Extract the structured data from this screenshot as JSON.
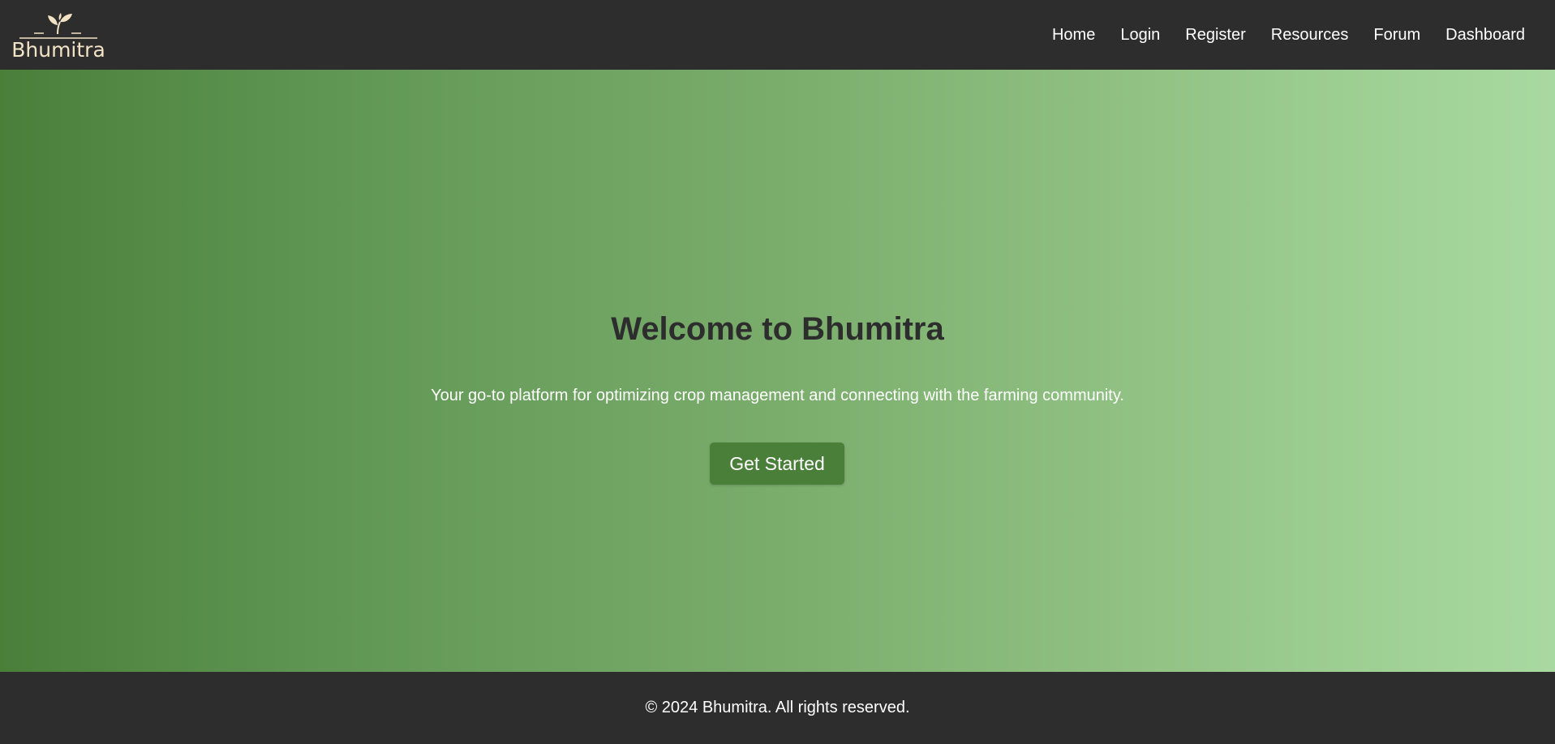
{
  "header": {
    "logo_text": "Bhumitra",
    "nav": [
      {
        "label": "Home"
      },
      {
        "label": "Login"
      },
      {
        "label": "Register"
      },
      {
        "label": "Resources"
      },
      {
        "label": "Forum"
      },
      {
        "label": "Dashboard"
      }
    ]
  },
  "hero": {
    "title": "Welcome to Bhumitra",
    "subtitle": "Your go-to platform for optimizing crop management and connecting with the farming community.",
    "cta_label": "Get Started"
  },
  "footer": {
    "copyright": "© 2024 Bhumitra. All rights reserved."
  },
  "colors": {
    "nav_bg": "#2d2d2d",
    "logo": "#f3e3c6",
    "button": "#4a7f3a",
    "gradient_start": "#4a7f3a",
    "gradient_end": "#a8d9a0",
    "title_text": "#2d2d2d"
  },
  "icons": {
    "logo_mark": "sprout-icon"
  }
}
